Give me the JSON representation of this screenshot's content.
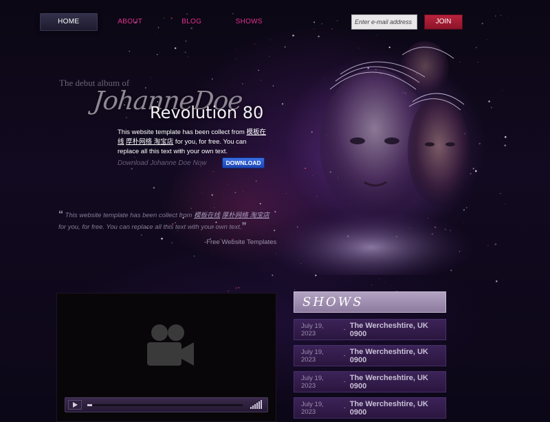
{
  "nav": {
    "items": [
      {
        "label": "HOME",
        "active": true
      },
      {
        "label": "ABOUT",
        "active": false
      },
      {
        "label": "BLOG",
        "active": false
      },
      {
        "label": "SHOWS",
        "active": false
      }
    ],
    "email_placeholder": "Enter e-mail address",
    "join_label": "JOIN"
  },
  "hero": {
    "debut": "The debut album of",
    "artist": "JohanneDoe",
    "album": "Revolution 80",
    "description": {
      "prefix": "This website template has been collect from ",
      "link1": "模板在线",
      "link2": "厚朴网络 淘宝店",
      "suffix": " for you, for free. You can replace all this text with your own text."
    },
    "download_text": "Download Johanne Doe Now",
    "download_button": "DOWNLOAD"
  },
  "quote": {
    "open_mark": "“",
    "prefix": "This website template has been collect from ",
    "link1": "模板在线",
    "link2": "厚朴网络 淘宝店",
    "suffix": " for you, for free. You can replace all this text with your own text.",
    "close_mark": "”",
    "source": "-Free Website Templates"
  },
  "video": {
    "icon": "video-camera-icon",
    "progress": 0.03
  },
  "shows": {
    "title": "SHOWS",
    "items": [
      {
        "date": "July 19, 2023",
        "sep": "-",
        "venue": "The Wercheshtire, UK 0900"
      },
      {
        "date": "July 19, 2023",
        "sep": "-",
        "venue": "The Wercheshtire, UK 0900"
      },
      {
        "date": "July 19, 2023",
        "sep": "-",
        "venue": "The Wercheshtire, UK 0900"
      },
      {
        "date": "July 19, 2023",
        "sep": "-",
        "venue": "The Wercheshtire, UK 0900"
      }
    ]
  },
  "colors": {
    "nav_link": "#e2318f",
    "join_button": "#b8243d",
    "download_button": "#2f5fd6",
    "shows_header": "#a897b8",
    "show_row": "#35204d"
  }
}
